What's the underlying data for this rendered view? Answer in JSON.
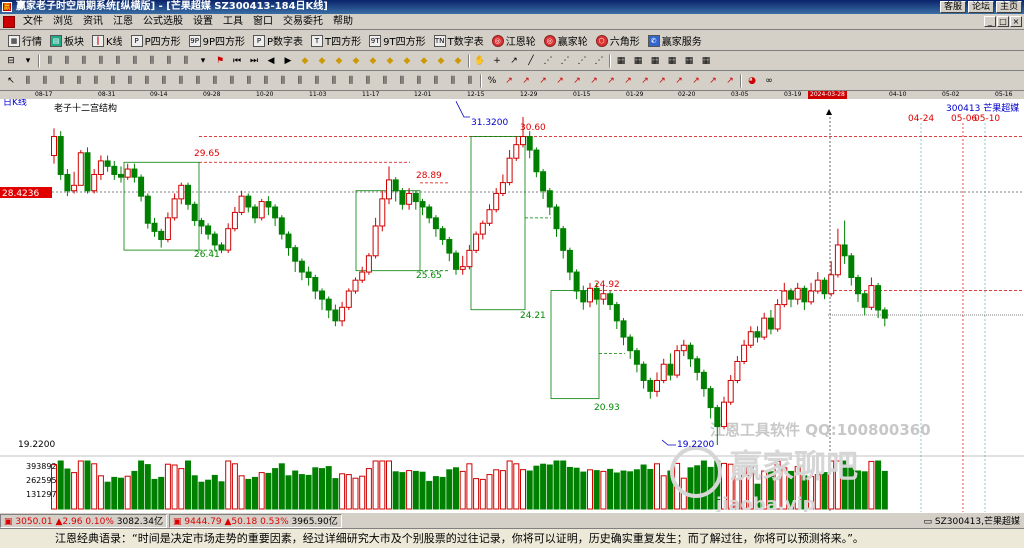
{
  "window": {
    "title": "赢家老子时空周期系统[纵横版] - [芒果超媒  SZ300413-184日K线]",
    "right_buttons": [
      "客服",
      "论坛",
      "主页"
    ],
    "mdi_buttons": [
      "_",
      "□",
      "×"
    ]
  },
  "menu": [
    "文件",
    "浏览",
    "资讯",
    "江恩",
    "公式选股",
    "设置",
    "工具",
    "窗口",
    "交易委托",
    "帮助"
  ],
  "toolbar1": [
    {
      "label": "行情",
      "icon": "grid-icon"
    },
    {
      "label": "板块",
      "icon": "blocks-icon"
    },
    {
      "label": "K线",
      "icon": "kline-icon"
    },
    {
      "label": "P四方形",
      "icon": "p-square-icon"
    },
    {
      "label": "9P四方形",
      "icon": "9p-square-icon"
    },
    {
      "label": "P数字表",
      "icon": "p-table-icon"
    },
    {
      "label": "T四方形",
      "icon": "t-square-icon"
    },
    {
      "label": "9T四方形",
      "icon": "9t-square-icon"
    },
    {
      "label": "T数字表",
      "icon": "t-table-icon"
    },
    {
      "label": "江恩轮",
      "icon": "gann-wheel-icon"
    },
    {
      "label": "赢家轮",
      "icon": "winner-wheel-icon"
    },
    {
      "label": "六角形",
      "icon": "hexagon-icon"
    },
    {
      "label": "赢家服务",
      "icon": "service-icon"
    }
  ],
  "date_axis": {
    "ticks": [
      "08-17",
      "08-31",
      "09-14",
      "09-28",
      "10-20",
      "11-03",
      "11-17",
      "12-01",
      "12-15",
      "12-29",
      "01-15",
      "01-29",
      "02-20",
      "03-05",
      "03-19",
      "04-10",
      "05-02",
      "05-16"
    ],
    "current": "2024-03-28"
  },
  "chart": {
    "period_label": "日K线",
    "structure_label": "老子十二宫结构",
    "stock_code_name": "300413 芒果超媒",
    "cursor_price": "28.4236",
    "price_labels": [
      "31.3200",
      "30.60",
      "29.65",
      "28.89",
      "26.41",
      "25.65",
      "24.92",
      "24.21",
      "20.93",
      "19.2200"
    ],
    "bottom_price_axis": "19.2200",
    "future_dates": [
      "04-24",
      "05-06",
      "05-10"
    ],
    "volume_ticks": [
      "393892",
      "262595",
      "131297"
    ],
    "watermark_line1": "江恩工具软件   QQ:100800360",
    "watermark_line2": "赢家聊吧",
    "watermark_line3": "jiaoba.vip",
    "colors": {
      "up": "#d00000",
      "down": "#008000",
      "box": "#008000",
      "dashed_red": "#d00000",
      "blue": "#0000c0"
    }
  },
  "chart_data": {
    "type": "candlestick",
    "title": "老子十二宫结构",
    "ylim": [
      19.22,
      32.2
    ],
    "candles": [
      [
        29.9,
        30.6,
        30.9,
        29.6
      ],
      [
        30.6,
        29.2,
        30.8,
        29.0
      ],
      [
        29.2,
        28.6,
        29.4,
        28.4
      ],
      [
        28.6,
        28.8,
        29.3,
        28.5
      ],
      [
        28.8,
        30.0,
        30.1,
        28.8
      ],
      [
        30.0,
        28.6,
        30.2,
        28.5
      ],
      [
        28.6,
        29.2,
        29.4,
        28.5
      ],
      [
        29.2,
        29.7,
        29.9,
        29.0
      ],
      [
        29.7,
        29.5,
        29.9,
        29.3
      ],
      [
        29.5,
        29.2,
        29.7,
        29.0
      ],
      [
        29.2,
        29.1,
        29.5,
        28.9
      ],
      [
        29.1,
        29.4,
        29.6,
        29.0
      ],
      [
        29.4,
        29.1,
        29.6,
        28.9
      ],
      [
        29.1,
        28.4,
        29.2,
        28.2
      ],
      [
        28.4,
        27.4,
        28.5,
        27.2
      ],
      [
        27.4,
        27.1,
        27.6,
        26.9
      ],
      [
        27.1,
        26.8,
        27.2,
        26.5
      ],
      [
        26.8,
        27.6,
        27.8,
        26.7
      ],
      [
        27.6,
        28.3,
        28.5,
        27.5
      ],
      [
        28.3,
        28.8,
        28.9,
        28.1
      ],
      [
        28.8,
        28.1,
        28.9,
        27.9
      ],
      [
        28.1,
        27.5,
        28.2,
        27.3
      ],
      [
        27.5,
        27.3,
        27.6,
        27.0
      ],
      [
        27.3,
        27.0,
        27.4,
        26.8
      ],
      [
        27.0,
        26.6,
        27.1,
        26.4
      ],
      [
        26.6,
        26.41,
        26.7,
        26.3
      ],
      [
        26.41,
        27.2,
        27.4,
        26.3
      ],
      [
        27.2,
        27.8,
        28.0,
        27.1
      ],
      [
        27.8,
        28.4,
        28.6,
        27.7
      ],
      [
        28.4,
        28.0,
        28.5,
        27.8
      ],
      [
        28.0,
        27.6,
        28.1,
        27.4
      ],
      [
        27.6,
        28.2,
        28.3,
        27.5
      ],
      [
        28.2,
        28.0,
        28.4,
        27.7
      ],
      [
        28.0,
        27.6,
        28.1,
        27.3
      ],
      [
        27.6,
        27.0,
        27.7,
        26.8
      ],
      [
        27.0,
        26.5,
        27.1,
        26.2
      ],
      [
        26.5,
        26.0,
        26.6,
        25.6
      ],
      [
        26.0,
        25.6,
        26.1,
        25.3
      ],
      [
        25.6,
        25.4,
        25.8,
        25.1
      ],
      [
        25.4,
        24.9,
        25.5,
        24.6
      ],
      [
        24.9,
        24.6,
        25.0,
        24.2
      ],
      [
        24.6,
        24.2,
        24.7,
        23.9
      ],
      [
        24.2,
        23.8,
        24.4,
        23.6
      ],
      [
        23.8,
        24.3,
        24.5,
        23.6
      ],
      [
        24.3,
        24.9,
        25.0,
        24.2
      ],
      [
        24.9,
        25.3,
        25.4,
        24.8
      ],
      [
        25.3,
        25.6,
        25.8,
        25.2
      ],
      [
        25.6,
        26.2,
        26.3,
        25.5
      ],
      [
        26.2,
        27.3,
        27.6,
        26.1
      ],
      [
        27.3,
        28.3,
        28.6,
        27.1
      ],
      [
        28.3,
        29.0,
        29.5,
        28.1
      ],
      [
        29.0,
        28.6,
        29.1,
        28.2
      ],
      [
        28.6,
        28.1,
        28.7,
        27.9
      ],
      [
        28.1,
        28.5,
        28.7,
        27.9
      ],
      [
        28.5,
        28.2,
        28.6,
        27.9
      ],
      [
        28.2,
        28.0,
        28.3,
        27.7
      ],
      [
        28.0,
        27.6,
        28.1,
        27.4
      ],
      [
        27.6,
        27.2,
        27.7,
        26.9
      ],
      [
        27.2,
        26.8,
        27.3,
        26.6
      ],
      [
        26.8,
        26.3,
        26.9,
        26.0
      ],
      [
        26.3,
        25.7,
        26.4,
        25.5
      ],
      [
        25.7,
        25.8,
        26.2,
        25.5
      ],
      [
        25.8,
        26.4,
        26.6,
        25.7
      ],
      [
        26.4,
        27.0,
        27.1,
        26.3
      ],
      [
        27.0,
        27.4,
        27.5,
        26.8
      ],
      [
        27.4,
        27.9,
        28.1,
        27.3
      ],
      [
        27.9,
        28.5,
        28.7,
        27.8
      ],
      [
        28.5,
        28.9,
        29.2,
        28.4
      ],
      [
        28.9,
        29.8,
        30.1,
        28.8
      ],
      [
        29.8,
        30.3,
        30.6,
        29.7
      ],
      [
        30.3,
        30.6,
        31.32,
        30.2
      ],
      [
        30.6,
        30.1,
        30.8,
        29.8
      ],
      [
        30.1,
        29.3,
        30.2,
        29.1
      ],
      [
        29.3,
        28.6,
        29.4,
        28.3
      ],
      [
        28.6,
        28.0,
        28.7,
        27.7
      ],
      [
        28.0,
        27.2,
        28.1,
        26.9
      ],
      [
        27.2,
        26.4,
        27.3,
        26.1
      ],
      [
        26.4,
        25.6,
        26.5,
        25.3
      ],
      [
        25.6,
        24.9,
        25.7,
        24.6
      ],
      [
        24.9,
        24.5,
        25.1,
        24.21
      ],
      [
        24.5,
        25.0,
        25.2,
        24.3
      ],
      [
        25.0,
        24.6,
        25.2,
        24.4
      ],
      [
        24.6,
        24.8,
        25.1,
        24.4
      ],
      [
        24.8,
        24.4,
        24.9,
        24.2
      ],
      [
        24.4,
        23.8,
        24.5,
        23.5
      ],
      [
        23.8,
        23.2,
        23.9,
        22.9
      ],
      [
        23.2,
        22.7,
        23.3,
        22.4
      ],
      [
        22.7,
        22.2,
        22.8,
        21.9
      ],
      [
        22.2,
        21.6,
        22.3,
        21.3
      ],
      [
        21.6,
        21.2,
        21.7,
        20.93
      ],
      [
        21.2,
        21.6,
        21.9,
        21.0
      ],
      [
        21.6,
        22.2,
        22.4,
        21.5
      ],
      [
        22.2,
        21.8,
        22.6,
        21.6
      ],
      [
        21.8,
        22.7,
        22.9,
        21.7
      ],
      [
        22.7,
        22.9,
        23.1,
        22.5
      ],
      [
        22.9,
        22.4,
        23.0,
        22.1
      ],
      [
        22.4,
        21.9,
        22.5,
        21.6
      ],
      [
        21.9,
        21.3,
        22.0,
        21.0
      ],
      [
        21.3,
        20.6,
        21.4,
        20.2
      ],
      [
        20.6,
        19.9,
        20.7,
        19.22
      ],
      [
        19.9,
        20.8,
        21.0,
        19.8
      ],
      [
        20.8,
        21.6,
        21.8,
        20.7
      ],
      [
        21.6,
        22.3,
        22.5,
        21.5
      ],
      [
        22.3,
        22.9,
        23.1,
        22.2
      ],
      [
        22.9,
        23.4,
        23.6,
        22.8
      ],
      [
        23.4,
        23.2,
        23.6,
        23.0
      ],
      [
        23.2,
        23.9,
        24.1,
        23.1
      ],
      [
        23.9,
        23.5,
        24.2,
        23.3
      ],
      [
        23.5,
        24.4,
        24.6,
        23.4
      ],
      [
        24.4,
        24.9,
        25.2,
        24.3
      ],
      [
        24.9,
        24.6,
        25.0,
        24.3
      ],
      [
        24.6,
        25.0,
        25.2,
        24.4
      ],
      [
        25.0,
        24.5,
        25.1,
        24.2
      ],
      [
        24.5,
        24.9,
        25.2,
        24.4
      ],
      [
        24.9,
        25.3,
        25.6,
        24.8
      ],
      [
        25.3,
        24.8,
        25.4,
        24.6
      ],
      [
        24.8,
        25.5,
        26.0,
        24.7
      ],
      [
        25.5,
        26.6,
        27.2,
        25.4
      ],
      [
        26.6,
        26.2,
        27.5,
        25.9
      ],
      [
        26.2,
        25.4,
        26.3,
        25.1
      ],
      [
        25.4,
        24.8,
        25.5,
        24.5
      ],
      [
        24.8,
        24.3,
        24.9,
        24.0
      ],
      [
        24.3,
        25.1,
        25.4,
        24.2
      ],
      [
        25.1,
        24.2,
        25.2,
        23.9
      ],
      [
        24.2,
        23.9,
        24.3,
        23.6
      ]
    ],
    "price_levels": [
      {
        "label": "31.3200",
        "value": 31.32
      },
      {
        "label": "30.60",
        "value": 30.6
      },
      {
        "label": "29.65",
        "value": 29.65
      },
      {
        "label": "28.89",
        "value": 28.89
      },
      {
        "label": "26.41",
        "value": 26.41
      },
      {
        "label": "25.65",
        "value": 25.65
      },
      {
        "label": "24.92",
        "value": 24.92
      },
      {
        "label": "24.21",
        "value": 24.21
      },
      {
        "label": "20.93",
        "value": 20.93
      },
      {
        "label": "19.2200",
        "value": 19.22
      }
    ],
    "volume_ticks": [
      393892,
      262595,
      131297
    ]
  },
  "status": {
    "sh_index": "3050.01",
    "sh_change": "2.96",
    "sh_pct": "0.10%",
    "sh_amount": "3082.34亿",
    "sz_index": "9444.79",
    "sz_change": "50.18",
    "sz_pct": "0.53%",
    "sz_amount": "3965.90亿",
    "right": "SZ300413,芒果超媒"
  },
  "quote": "江恩经典语录：“时间是决定市场走势的重要因素，经过详细研究大市及个别股票的过往记录，你将可以证明，历史确实重复发生；而了解过往，你将可以预测将来。”。"
}
